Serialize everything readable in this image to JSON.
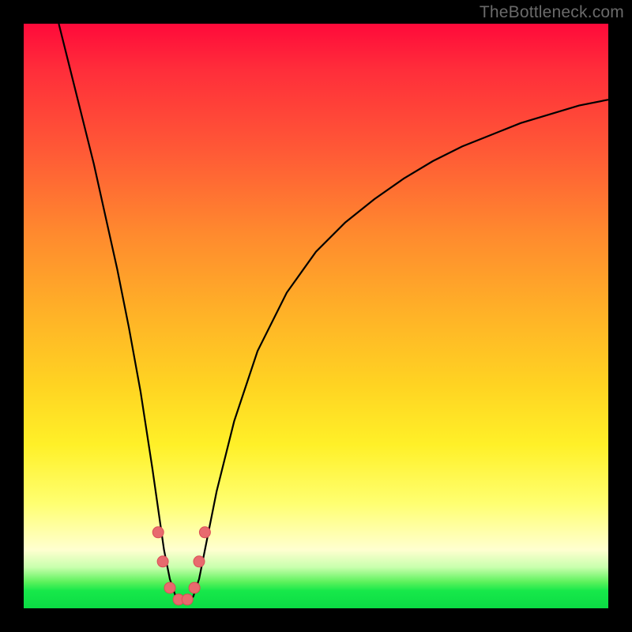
{
  "watermark": "TheBottleneck.com",
  "colors": {
    "frame": "#000000",
    "grad_top": "#ff0a3a",
    "grad_mid": "#ffd422",
    "grad_low": "#ffffd0",
    "grad_green": "#17e84a",
    "curve_stroke": "#000000",
    "marker_fill": "#e86a6e",
    "marker_stroke": "#da4e56"
  },
  "chart_data": {
    "type": "line",
    "title": "",
    "xlabel": "",
    "ylabel": "",
    "xlim": [
      0,
      100
    ],
    "ylim": [
      0,
      100
    ],
    "grid": false,
    "series": [
      {
        "name": "bottleneck-curve",
        "x": [
          6,
          8,
          10,
          12,
          14,
          16,
          18,
          20,
          22,
          23,
          24,
          25,
          26,
          27,
          28,
          29,
          30,
          31,
          33,
          36,
          40,
          45,
          50,
          55,
          60,
          65,
          70,
          75,
          80,
          85,
          90,
          95,
          100
        ],
        "values": [
          100,
          92,
          84,
          76,
          67,
          58,
          48,
          37,
          24,
          17,
          10,
          5,
          2,
          1,
          1,
          2,
          5,
          10,
          20,
          32,
          44,
          54,
          61,
          66,
          70,
          73.5,
          76.5,
          79,
          81,
          83,
          84.5,
          86,
          87
        ]
      }
    ],
    "markers": {
      "name": "fit-points",
      "x": [
        23.0,
        23.8,
        25.0,
        26.5,
        28.0,
        29.2,
        30.0,
        31.0
      ],
      "values": [
        13.0,
        8.0,
        3.5,
        1.5,
        1.5,
        3.5,
        8.0,
        13.0
      ]
    },
    "notch_x": 27
  }
}
